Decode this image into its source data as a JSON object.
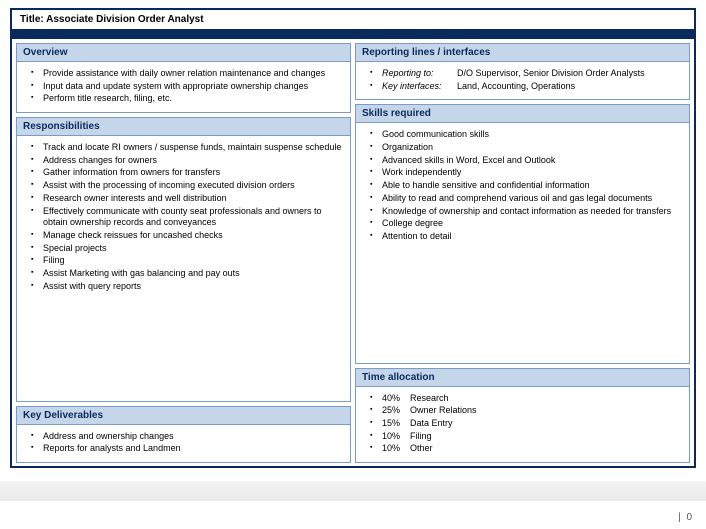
{
  "title": "Title: Associate Division Order Analyst",
  "overview": {
    "header": "Overview",
    "items": [
      "Provide assistance with daily owner relation maintenance and changes",
      "Input data and update system with appropriate ownership changes",
      "Perform title research, filing, etc."
    ]
  },
  "responsibilities": {
    "header": "Responsibilities",
    "items": [
      "Track and locate RI owners / suspense funds, maintain suspense schedule",
      "Address changes for owners",
      "Gather information from owners for transfers",
      "Assist with the processing of incoming executed division orders",
      "Research owner interests and well distribution",
      "Effectively communicate with county seat professionals and owners to obtain ownership records and conveyances",
      "Manage check reissues for uncashed checks",
      "Special projects",
      "Filing",
      "Assist Marketing with gas balancing and pay outs",
      "Assist with query reports"
    ]
  },
  "deliverables": {
    "header": "Key Deliverables",
    "items": [
      "Address and ownership changes",
      "Reports for analysts and Landmen"
    ]
  },
  "reporting": {
    "header": "Reporting lines / interfaces",
    "rows": [
      {
        "label": "Reporting to:",
        "value": "D/O Supervisor, Senior Division Order Analysts"
      },
      {
        "label": "Key interfaces:",
        "value": "Land, Accounting, Operations"
      }
    ]
  },
  "skills": {
    "header": "Skills required",
    "items": [
      "Good communication skills",
      "Organization",
      "Advanced skills in Word, Excel and Outlook",
      "Work independently",
      "Able to handle sensitive and confidential information",
      "Ability to read and comprehend various oil and gas legal documents",
      "Knowledge of ownership and contact information as needed for transfers",
      "College degree",
      "Attention to detail"
    ]
  },
  "time": {
    "header": "Time allocation",
    "rows": [
      {
        "pct": "40%",
        "label": "Research"
      },
      {
        "pct": "25%",
        "label": "Owner Relations"
      },
      {
        "pct": "15%",
        "label": "Data Entry"
      },
      {
        "pct": "10%",
        "label": "Filing"
      },
      {
        "pct": "10%",
        "label": "Other"
      }
    ]
  },
  "footer": {
    "sep": "|",
    "page": "0"
  }
}
